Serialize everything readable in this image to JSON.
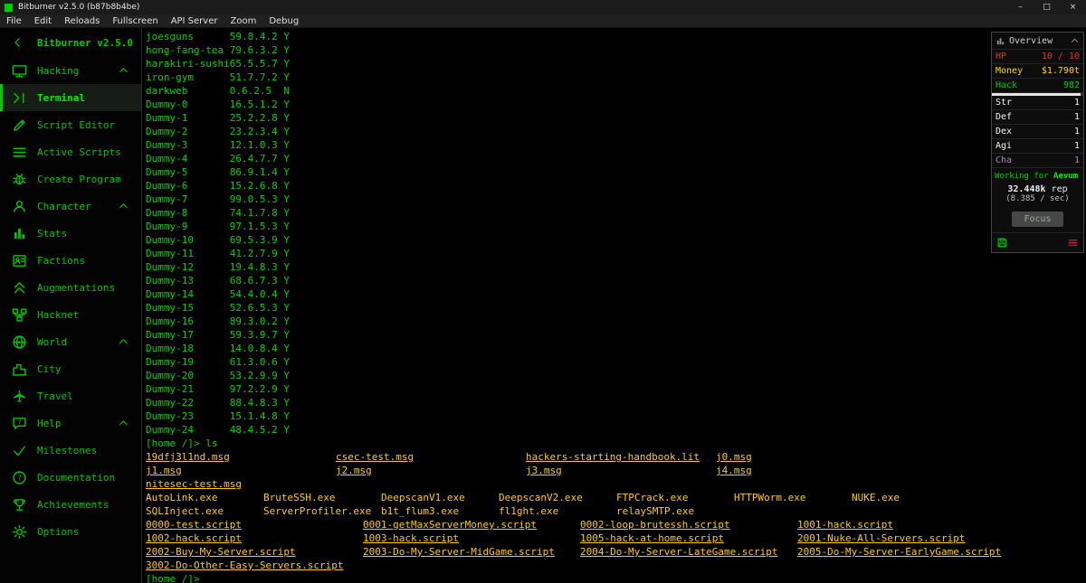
{
  "window": {
    "title": "Bitburner v2.5.0 (b87b8b4be)",
    "menu": [
      "File",
      "Edit",
      "Reloads",
      "Fullscreen",
      "API Server",
      "Zoom",
      "Debug"
    ],
    "controls": [
      "–",
      "□",
      "×"
    ]
  },
  "sidebar": {
    "header": "Bitburner v2.5.0",
    "sections": [
      {
        "label": "Hacking",
        "icon": "monitor-icon",
        "items": [
          {
            "label": "Terminal",
            "icon": "terminal-icon",
            "selected": true
          },
          {
            "label": "Script Editor",
            "icon": "pencil-icon",
            "selected": false
          },
          {
            "label": "Active Scripts",
            "icon": "storage-icon",
            "selected": false
          },
          {
            "label": "Create Program",
            "icon": "bug-icon",
            "selected": false
          }
        ]
      },
      {
        "label": "Character",
        "icon": "person-icon",
        "items": [
          {
            "label": "Stats",
            "icon": "stats-icon",
            "selected": false
          },
          {
            "label": "Factions",
            "icon": "factions-icon",
            "selected": false
          },
          {
            "label": "Augmentations",
            "icon": "augmentations-icon",
            "selected": false
          },
          {
            "label": "Hacknet",
            "icon": "hacknet-icon",
            "selected": false
          }
        ]
      },
      {
        "label": "World",
        "icon": "globe-icon",
        "items": [
          {
            "label": "City",
            "icon": "city-icon",
            "selected": false
          },
          {
            "label": "Travel",
            "icon": "travel-icon",
            "selected": false
          }
        ]
      },
      {
        "label": "Help",
        "icon": "livehelp-icon",
        "items": [
          {
            "label": "Milestones",
            "icon": "check-icon",
            "selected": false
          },
          {
            "label": "Documentation",
            "icon": "docs-icon",
            "selected": false
          },
          {
            "label": "Achievements",
            "icon": "trophy-icon",
            "selected": false
          },
          {
            "label": "Options",
            "icon": "gear-icon",
            "selected": false
          }
        ]
      }
    ]
  },
  "terminal": {
    "prompt": "[home /]>",
    "command": "ls",
    "scan_rows": [
      {
        "host": "joesguns",
        "ip": "59.8.4.2",
        "flag": "Y"
      },
      {
        "host": "hong-fang-tea",
        "ip": "79.6.3.2",
        "flag": "Y"
      },
      {
        "host": "harakiri-sushi",
        "ip": "65.5.5.7",
        "flag": "Y"
      },
      {
        "host": "iron-gym",
        "ip": "51.7.7.2",
        "flag": "Y"
      },
      {
        "host": "darkweb",
        "ip": "0.6.2.5",
        "flag": "N"
      },
      {
        "host": "Dummy-0",
        "ip": "16.5.1.2",
        "flag": "Y"
      },
      {
        "host": "Dummy-1",
        "ip": "25.2.2.8",
        "flag": "Y"
      },
      {
        "host": "Dummy-2",
        "ip": "23.2.3.4",
        "flag": "Y"
      },
      {
        "host": "Dummy-3",
        "ip": "12.1.0.3",
        "flag": "Y"
      },
      {
        "host": "Dummy-4",
        "ip": "26.4.7.7",
        "flag": "Y"
      },
      {
        "host": "Dummy-5",
        "ip": "86.9.1.4",
        "flag": "Y"
      },
      {
        "host": "Dummy-6",
        "ip": "15.2.6.8",
        "flag": "Y"
      },
      {
        "host": "Dummy-7",
        "ip": "99.0.5.3",
        "flag": "Y"
      },
      {
        "host": "Dummy-8",
        "ip": "74.1.7.8",
        "flag": "Y"
      },
      {
        "host": "Dummy-9",
        "ip": "97.1.5.3",
        "flag": "Y"
      },
      {
        "host": "Dummy-10",
        "ip": "69.5.3.9",
        "flag": "Y"
      },
      {
        "host": "Dummy-11",
        "ip": "41.2.7.9",
        "flag": "Y"
      },
      {
        "host": "Dummy-12",
        "ip": "19.4.8.3",
        "flag": "Y"
      },
      {
        "host": "Dummy-13",
        "ip": "68.6.7.3",
        "flag": "Y"
      },
      {
        "host": "Dummy-14",
        "ip": "54.4.0.4",
        "flag": "Y"
      },
      {
        "host": "Dummy-15",
        "ip": "52.6.5.3",
        "flag": "Y"
      },
      {
        "host": "Dummy-16",
        "ip": "89.3.0.2",
        "flag": "Y"
      },
      {
        "host": "Dummy-17",
        "ip": "59.3.9.7",
        "flag": "Y"
      },
      {
        "host": "Dummy-18",
        "ip": "14.0.8.4",
        "flag": "Y"
      },
      {
        "host": "Dummy-19",
        "ip": "61.3.0.6",
        "flag": "Y"
      },
      {
        "host": "Dummy-20",
        "ip": "53.2.9.9",
        "flag": "Y"
      },
      {
        "host": "Dummy-21",
        "ip": "97.2.2.9",
        "flag": "Y"
      },
      {
        "host": "Dummy-22",
        "ip": "88.4.8.3",
        "flag": "Y"
      },
      {
        "host": "Dummy-23",
        "ip": "15.1.4.8",
        "flag": "Y"
      },
      {
        "host": "Dummy-24",
        "ip": "48.4.5.2",
        "flag": "Y"
      }
    ],
    "files": {
      "messages": [
        "19dfj3l1nd.msg",
        "csec-test.msg",
        "hackers-starting-handbook.lit",
        "j0.msg",
        "j1.msg",
        "j2.msg",
        "j3.msg",
        "j4.msg",
        "nitesec-test.msg"
      ],
      "programs": [
        "AutoLink.exe",
        "BruteSSH.exe",
        "DeepscanV1.exe",
        "DeepscanV2.exe",
        "FTPCrack.exe",
        "HTTPWorm.exe",
        "NUKE.exe",
        "SQLInject.exe",
        "ServerProfiler.exe",
        "b1t_flum3.exe",
        "fl1ght.exe",
        "relaySMTP.exe"
      ],
      "scripts": [
        "0000-test.script",
        "0001-getMaxServerMoney.script",
        "0002-loop-brutessh.script",
        "1001-hack.script",
        "1002-hack.script",
        "1003-hack.script",
        "1005-hack-at-home.script",
        "2001-Nuke-All-Servers.script",
        "2002-Buy-My-Server.script",
        "2003-Do-My-Server-MidGame.script",
        "2004-Do-My-Server-LateGame.script",
        "2005-Do-My-Server-EarlyGame.script",
        "3002-Do-Other-Easy-Servers.script"
      ]
    }
  },
  "overview": {
    "title": "Overview",
    "stats": [
      {
        "label": "HP",
        "value": "10 / 10",
        "color": "#dd3434"
      },
      {
        "label": "Money",
        "value": "$1.790t",
        "color": "#ffd700"
      },
      {
        "label": "Hack",
        "value": "982",
        "color": "#00cc00",
        "bar": 97
      },
      {
        "label": "Str",
        "value": "1",
        "color": "#f5f5f5"
      },
      {
        "label": "Def",
        "value": "1",
        "color": "#f5f5f5"
      },
      {
        "label": "Dex",
        "value": "1",
        "color": "#f5f5f5"
      },
      {
        "label": "Agi",
        "value": "1",
        "color": "#f5f5f5"
      },
      {
        "label": "Cha",
        "value": "1",
        "color": "#a98aba"
      }
    ],
    "working": {
      "prefix": "Working for ",
      "company": "Aevum"
    },
    "rep_amount": "32.448k",
    "rep_suffix": "rep",
    "rep_rate": "(8.385 / sec)",
    "focus_label": "Focus"
  },
  "colors": {
    "primary_green": "#00cc00",
    "bright_green": "#00ee00",
    "link_yellow": "#ffcc00",
    "hp_red": "#dd3434",
    "money_gold": "#ffd700",
    "kill_red": "#cc3030"
  }
}
